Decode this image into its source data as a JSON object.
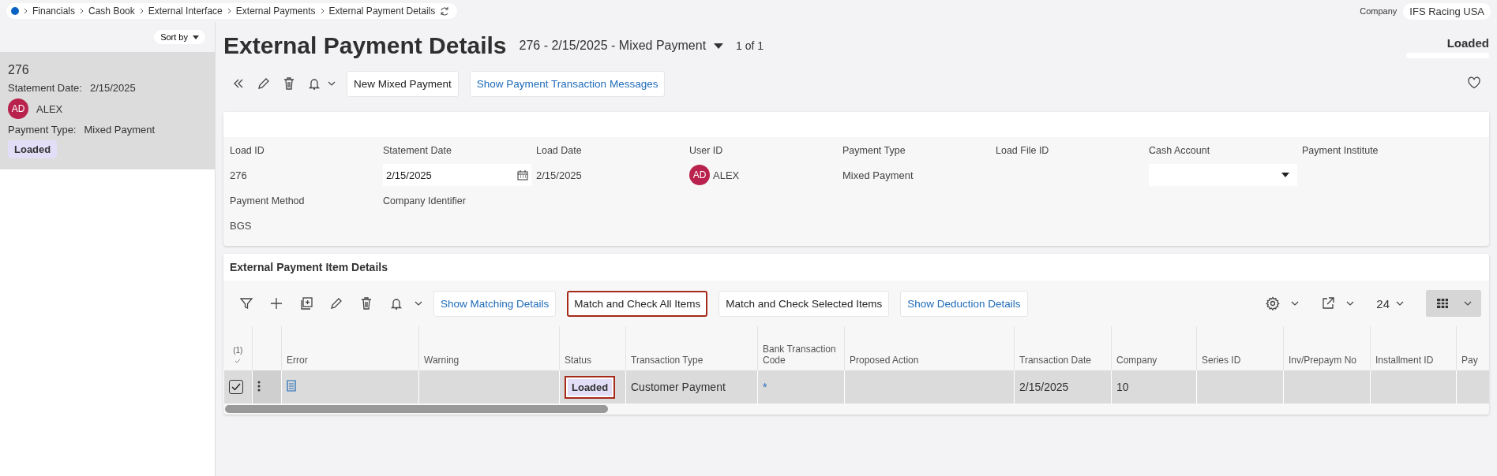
{
  "breadcrumb": {
    "items": [
      "Financials",
      "Cash Book",
      "External Interface",
      "External Payments",
      "External Payment Details"
    ]
  },
  "company": {
    "label": "Company",
    "value": "IFS Racing USA"
  },
  "sidebar": {
    "sort_label": "Sort by",
    "cards": [
      {
        "id": "276",
        "selected": true,
        "fields": [
          {
            "kind": "text",
            "label": "Statement Date:",
            "value": "2/15/2025"
          },
          {
            "kind": "avatar",
            "initials": "AD",
            "value": "ALEX"
          },
          {
            "kind": "text",
            "label": "Payment Type:",
            "value": "Mixed Payment"
          }
        ],
        "badge": "Loaded"
      }
    ]
  },
  "header": {
    "title": "External Payment Details",
    "record": "276 - 2/15/2025 - Mixed Payment",
    "counter": "1 of 1",
    "status": "Loaded"
  },
  "toolbar": {
    "buttons": [
      {
        "label": "New Mixed Payment",
        "kind": "plain"
      },
      {
        "label": "Show Payment Transaction Messages",
        "kind": "link"
      }
    ]
  },
  "form": {
    "fields": [
      {
        "label": "Load ID",
        "value": "276",
        "kind": "text"
      },
      {
        "label": "Statement Date",
        "value": "2/15/2025",
        "kind": "date"
      },
      {
        "label": "Load Date",
        "value": "2/15/2025",
        "kind": "text"
      },
      {
        "label": "User ID",
        "value": "ALEX",
        "initials": "AD",
        "kind": "avatar"
      },
      {
        "label": "Payment Type",
        "value": "Mixed Payment",
        "kind": "text"
      },
      {
        "label": "Load File ID",
        "kind": "text"
      },
      {
        "label": "Cash Account",
        "kind": "select"
      },
      {
        "label": "Payment Institute",
        "kind": "text"
      },
      {
        "label": "Payment Method",
        "value": "BGS",
        "kind": "text"
      },
      {
        "label": "Company Identifier",
        "kind": "text"
      }
    ]
  },
  "items": {
    "title": "External Payment Item Details",
    "buttons": [
      {
        "label": "Show Matching Details",
        "kind": "link",
        "highlighted": false
      },
      {
        "label": "Match and Check All Items",
        "kind": "plain",
        "highlighted": true
      },
      {
        "label": "Match and Check Selected Items",
        "kind": "plain",
        "highlighted": false
      },
      {
        "label": "Show Deduction Details",
        "kind": "link",
        "highlighted": false
      }
    ],
    "page_size": "24",
    "table": {
      "selected_count": "(1)",
      "columns": [
        "Error",
        "Warning",
        "Status",
        "Transaction Type",
        "Bank Transaction Code",
        "Proposed Action",
        "Transaction Date",
        "Company",
        "Series ID",
        "Inv/Prepaym No",
        "Installment ID",
        "Pay"
      ],
      "rows": [
        {
          "selected": true,
          "checked": true,
          "status": "Loaded",
          "status_highlighted": true,
          "transaction_type": "Customer Payment",
          "bank_transaction_code": "*",
          "transaction_date": "2/15/2025",
          "company": "10"
        }
      ]
    }
  }
}
